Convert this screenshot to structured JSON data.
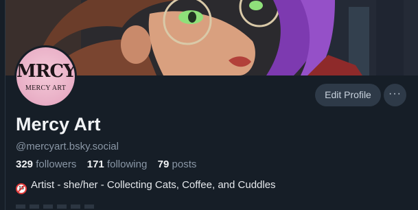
{
  "profile": {
    "avatar_mark": "MRCY",
    "avatar_subtitle": "MERCY ART",
    "display_name": "Mercy Art",
    "handle": "@mercyart.bsky.social",
    "stats": {
      "followers_count": "329",
      "followers_label": "followers",
      "following_count": "171",
      "following_label": "following",
      "posts_count": "79",
      "posts_label": "posts"
    },
    "bio": "Artist - she/her - Collecting Cats, Coffee, and Cuddles",
    "bio_icon": "no-under-18-icon"
  },
  "actions": {
    "edit_profile_label": "Edit Profile",
    "more_label": "···"
  },
  "colors": {
    "background": "#161e27",
    "button_bg": "#2e3a48",
    "text_primary": "#f1f3f5",
    "text_muted": "#8a97a6"
  }
}
